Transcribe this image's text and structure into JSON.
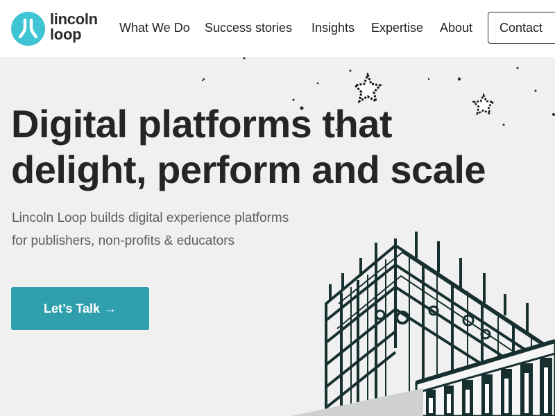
{
  "brand": {
    "name_line1": "lincoln",
    "name_line2": "loop",
    "color": "#3ec4d2",
    "icon": "lincoln-loop-logo-mark"
  },
  "nav": {
    "items": [
      "What We Do",
      "Success stories",
      "Insights",
      "Expertise",
      "About"
    ],
    "contact_label": "Contact"
  },
  "hero": {
    "title_line1": "Digital platforms that",
    "title_line2": "delight, perform and scale",
    "subtitle_line1": "Lincoln Loop builds digital experience platforms",
    "subtitle_line2": "for publishers, non-profits & educators",
    "cta_label": "Let’s Talk",
    "cta_icon": "arrow-right-icon",
    "cta_color": "#2f9fae",
    "illustration": "scaffolding-building-illustration"
  }
}
